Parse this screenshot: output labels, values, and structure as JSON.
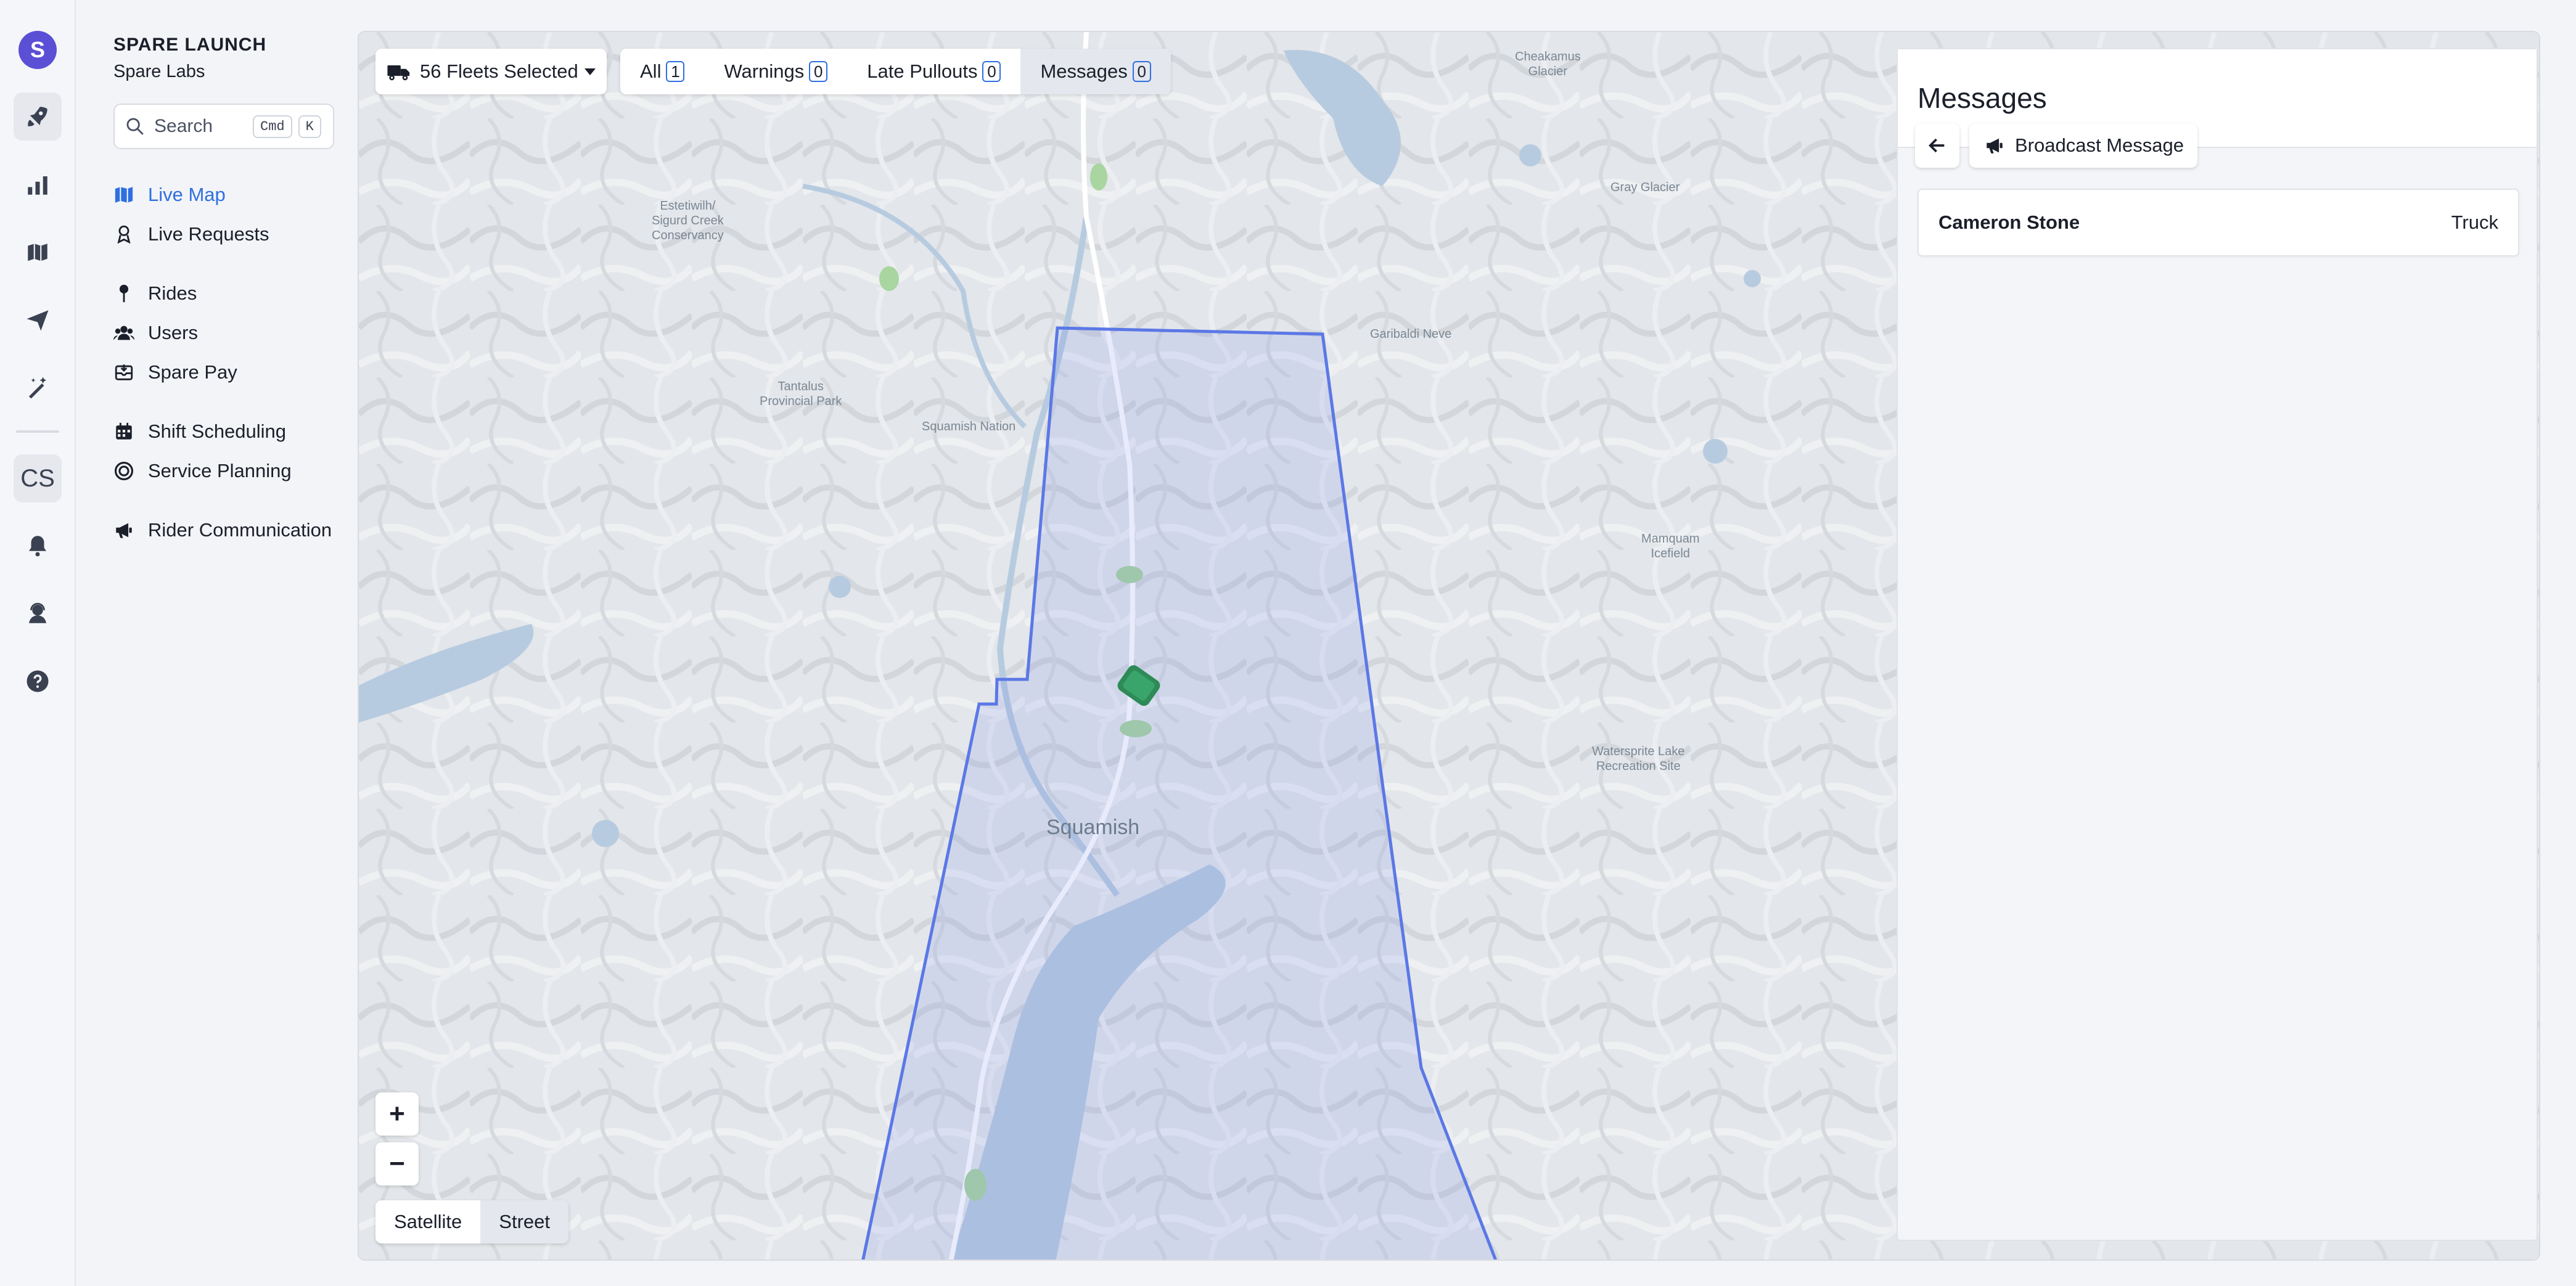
{
  "org": {
    "name": "SPARE LAUNCH",
    "subtitle": "Spare Labs"
  },
  "rail": {
    "logo_letter": "S",
    "user_initials": "CS",
    "items": [
      {
        "icon": "rocket-icon"
      },
      {
        "icon": "bar-chart-icon"
      },
      {
        "icon": "map-envelope-icon"
      },
      {
        "icon": "paper-plane-icon"
      },
      {
        "icon": "magic-wand-icon"
      },
      {
        "icon": "bell-icon"
      },
      {
        "icon": "support-agent-icon"
      },
      {
        "icon": "help-icon"
      }
    ],
    "accent_color": "#5b4fd6"
  },
  "search": {
    "placeholder": "Search",
    "shortcut_mod": "Cmd",
    "shortcut_key": "K"
  },
  "nav": {
    "items": [
      {
        "label": "Live Map",
        "icon": "map-icon",
        "active": true
      },
      {
        "label": "Live Requests",
        "icon": "person-badge-icon"
      },
      {
        "label": "Rides",
        "icon": "pin-icon"
      },
      {
        "label": "Users",
        "icon": "users-icon"
      },
      {
        "label": "Spare Pay",
        "icon": "wallet-icon"
      },
      {
        "label": "Shift Scheduling",
        "icon": "calendar-icon"
      },
      {
        "label": "Service Planning",
        "icon": "target-icon"
      },
      {
        "label": "Rider Communication",
        "icon": "megaphone-icon"
      }
    ],
    "active_color": "#2f6fe0"
  },
  "map": {
    "fleet_selector": "56 Fleets Selected",
    "tabs": [
      {
        "label": "All",
        "count": "1"
      },
      {
        "label": "Warnings",
        "count": "0"
      },
      {
        "label": "Late Pullouts",
        "count": "0"
      },
      {
        "label": "Messages",
        "count": "0",
        "active": true
      }
    ],
    "zoom_in": "+",
    "zoom_out": "−",
    "layers": [
      {
        "label": "Satellite"
      },
      {
        "label": "Street",
        "active": true
      }
    ],
    "labels": {
      "cheakamus": "Cheakamus\nGlacier",
      "estetiwilh": "Estetiwilh/\nSigurd Creek\nConservancy",
      "gray_glacier": "Gray Glacier",
      "garibaldi": "Garibaldi Neve",
      "tantalus": "Tantalus\nProvincial Park",
      "squamish_nation": "Squamish Nation",
      "mamquam": "Mamquam\nIcefield",
      "watersprite": "Watersprite Lake\nRecreation Site",
      "squamish": "Squamish"
    },
    "zone_color": "#5b78e6",
    "vehicle_color": "#2e8b57"
  },
  "messages": {
    "title": "Messages",
    "broadcast_label": "Broadcast Message",
    "conversations": [
      {
        "name": "Cameron Stone",
        "vehicle": "Truck"
      }
    ]
  }
}
